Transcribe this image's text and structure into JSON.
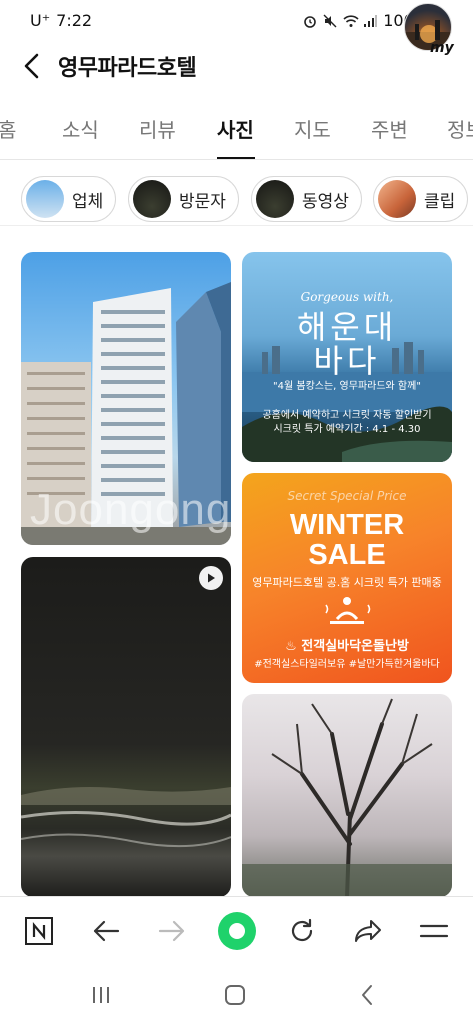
{
  "status": {
    "carrier": "U⁺",
    "time": "7:22",
    "battery": "100%"
  },
  "header": {
    "title": "영무파라드호텔",
    "avatar_tag": "my"
  },
  "tabs": [
    {
      "label": "홈"
    },
    {
      "label": "소식"
    },
    {
      "label": "리뷰"
    },
    {
      "label": "사진",
      "active": true
    },
    {
      "label": "지도"
    },
    {
      "label": "주변"
    },
    {
      "label": "정보"
    }
  ],
  "chips": [
    {
      "label": "업체"
    },
    {
      "label": "방문자"
    },
    {
      "label": "동영상"
    },
    {
      "label": "클립"
    }
  ],
  "photos": {
    "watermark": "Joongong.com",
    "promo_sea": {
      "eyebrow": "Gorgeous with,",
      "line1": "해운대",
      "line2": "바다",
      "subtitle": "\"4월 봄캉스는, 영무파라드와 함께\"",
      "line_a": "공홈에서 예약하고 시크릿 자동 할인받기",
      "line_b": "시크릿 특가 예약기간 : 4.1 - 4.30"
    },
    "promo_winter": {
      "eyebrow": "Secret Special Price",
      "word1": "WINTER",
      "word2": "SALE",
      "desc": "영무파라드호텔 공.홈 시크릿 특가 판매중",
      "feature": "♨ 전객실바닥온돌난방",
      "tags": "#전객실스타일러보유 #날만가득한겨울바다"
    }
  },
  "colors": {
    "active_tab": "#111111",
    "record_button": "#1fd26b",
    "winter_orange": "#f7832a"
  }
}
